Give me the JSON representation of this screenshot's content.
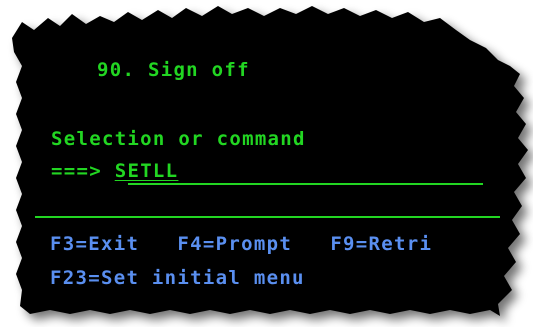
{
  "menu": {
    "option_number": "90.",
    "option_label": "Sign off"
  },
  "command": {
    "prompt_label": "Selection or command",
    "arrow": "===>",
    "value": "SETLL"
  },
  "function_keys": {
    "row1": [
      {
        "key": "F3",
        "label": "Exit"
      },
      {
        "key": "F4",
        "label": "Prompt"
      },
      {
        "key": "F9",
        "label": "Retri"
      }
    ],
    "row2": [
      {
        "key": "F23",
        "label": "Set initial menu"
      }
    ]
  },
  "colors": {
    "screen_background": "#000000",
    "text_green": "#22d622",
    "text_blue": "#5a8ff0"
  }
}
